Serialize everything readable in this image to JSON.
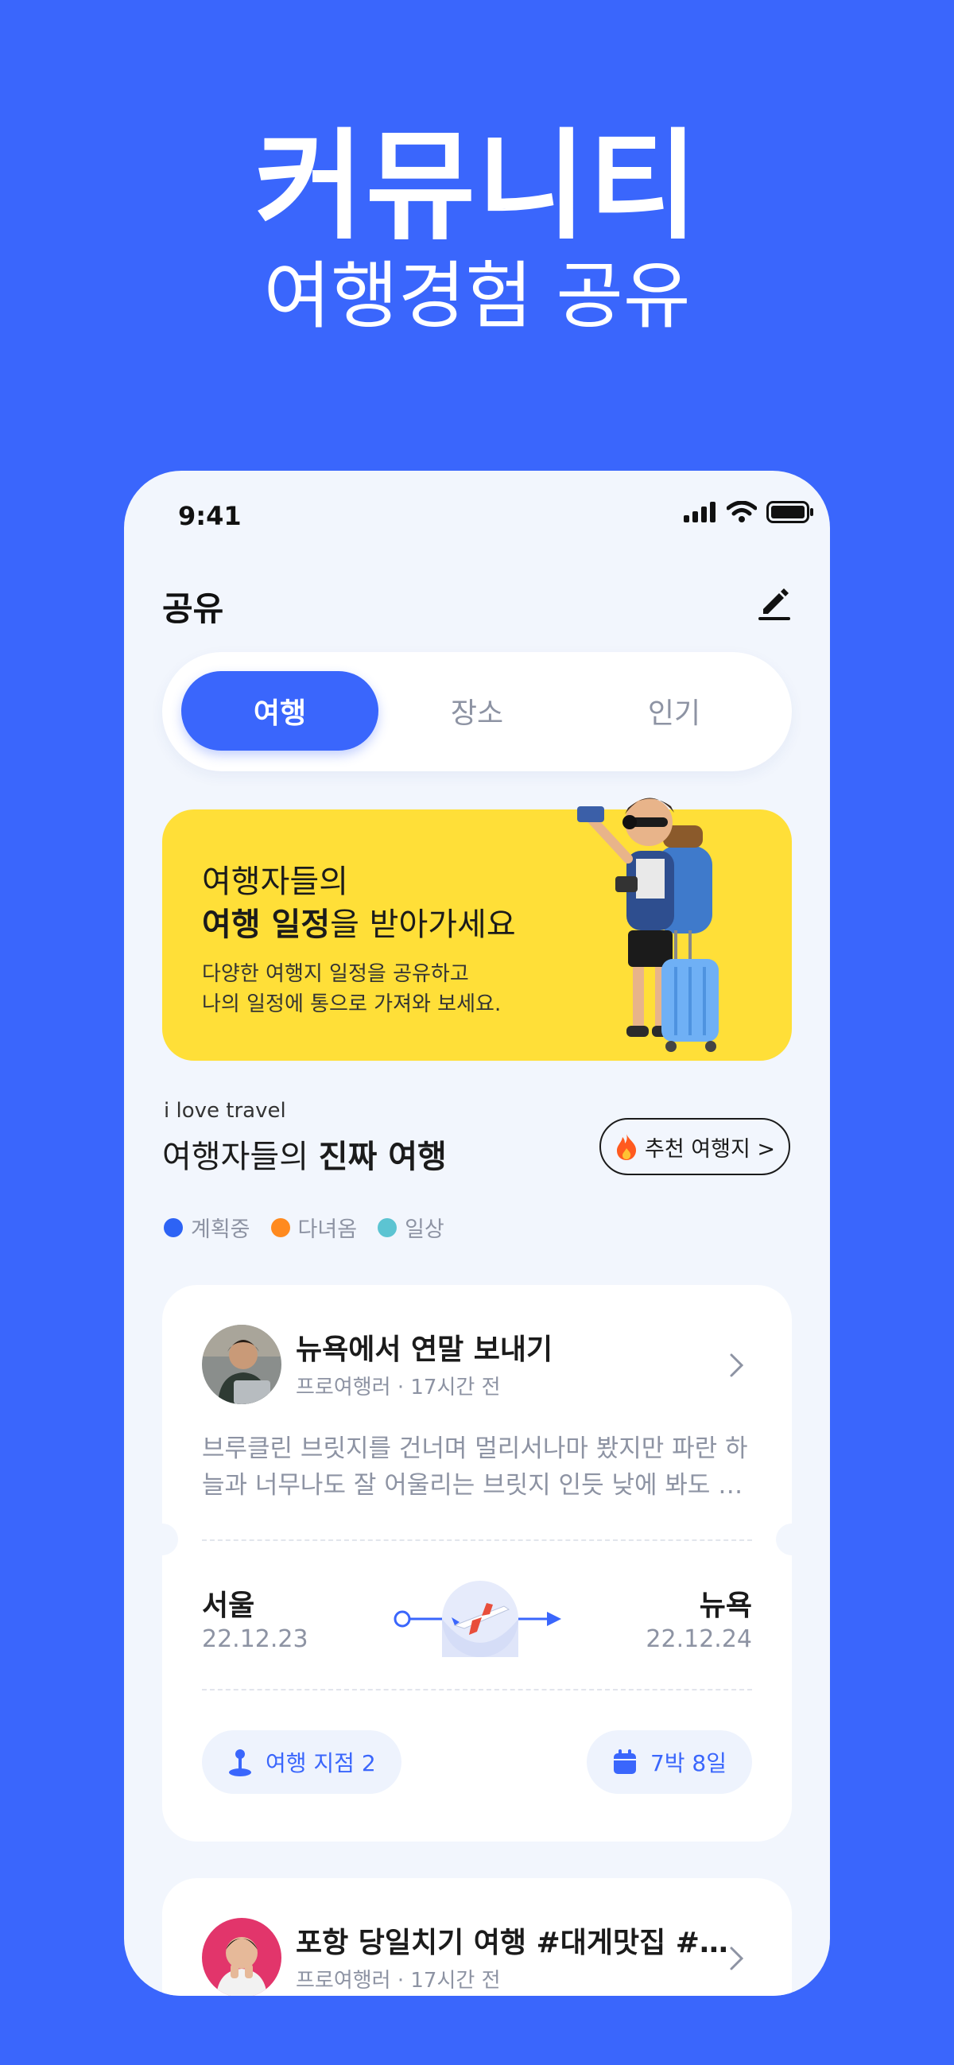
{
  "hero": {
    "title": "커뮤니티",
    "subtitle": "여행경험 공유"
  },
  "status_bar": {
    "time": "9:41"
  },
  "header": {
    "title": "공유"
  },
  "tabs": [
    {
      "label": "여행",
      "active": true
    },
    {
      "label": "장소",
      "active": false
    },
    {
      "label": "인기",
      "active": false
    }
  ],
  "banner": {
    "line1": "여행자들의",
    "line2_bold": "여행 일정",
    "line2_rest": "을 받아가세요",
    "desc1": "다양한 여행지 일정을 공유하고",
    "desc2": "나의 일정에 통으로 가져와 보세요."
  },
  "section": {
    "tagline": "i love travel",
    "title_prefix": "여행자들의 ",
    "title_bold": "진짜 여행",
    "recommend_button": "추천 여행지 >"
  },
  "legend": [
    {
      "label": "계획중",
      "color": "#2D63F5"
    },
    {
      "label": "다녀옴",
      "color": "#FF8A1F"
    },
    {
      "label": "일상",
      "color": "#5CC4D2"
    }
  ],
  "posts": [
    {
      "title": "뉴욕에서 연말 보내기",
      "meta": "프로여행러 · 17시간 전",
      "body_line1": "브루클린 브릿지를 건너며 멀리서나마 봤지만 파란 하",
      "body_line2": "늘과 너무나도 잘 어울리는 브릿지 인듯 낮에 봐도 예…",
      "from_city": "서울",
      "from_date": "22.12.23",
      "to_city": "뉴욕",
      "to_date": "22.12.24",
      "spots": "여행 지점 2",
      "duration": "7박 8일"
    },
    {
      "title": "포항 당일치기 여행 #대게맛집 #…",
      "meta": "프로여행러 · 17시간 전"
    }
  ],
  "colors": {
    "brand_blue": "#3A66FC",
    "banner_yellow": "#FFDF38",
    "screen_bg": "#F2F6FD"
  },
  "icons": [
    "signal-icon",
    "wifi-icon",
    "battery-icon",
    "edit-pencil-icon",
    "fire-icon",
    "chevron-right-icon",
    "pin-icon",
    "calendar-icon",
    "airplane-icon"
  ]
}
